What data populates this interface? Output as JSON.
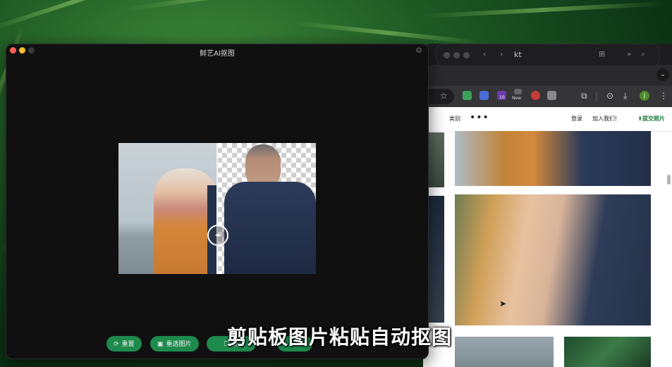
{
  "desktop": {
    "wallpaper": "green-grass"
  },
  "finder": {
    "title": "kt"
  },
  "browser": {
    "extension_badge": "10",
    "extension_new": "New",
    "profile_initial": "J",
    "site_nav": {
      "category": "类别",
      "more": "•••",
      "login": "登录",
      "join": "加入我们!",
      "submit": "提交照片"
    }
  },
  "app": {
    "title": "鲜艺AI抠图",
    "buttons": [
      {
        "label": "重置",
        "icon": "refresh-icon"
      },
      {
        "label": "重选图片",
        "icon": "image-icon"
      },
      {
        "label": "复",
        "icon": "copy-icon"
      },
      {
        "label": "",
        "icon": "save-icon"
      }
    ],
    "compare_handle": "◂▸"
  },
  "caption": "剪贴板图片粘贴自动抠图",
  "colors": {
    "accent": "#1e8a4c",
    "window_bg": "#101011"
  }
}
